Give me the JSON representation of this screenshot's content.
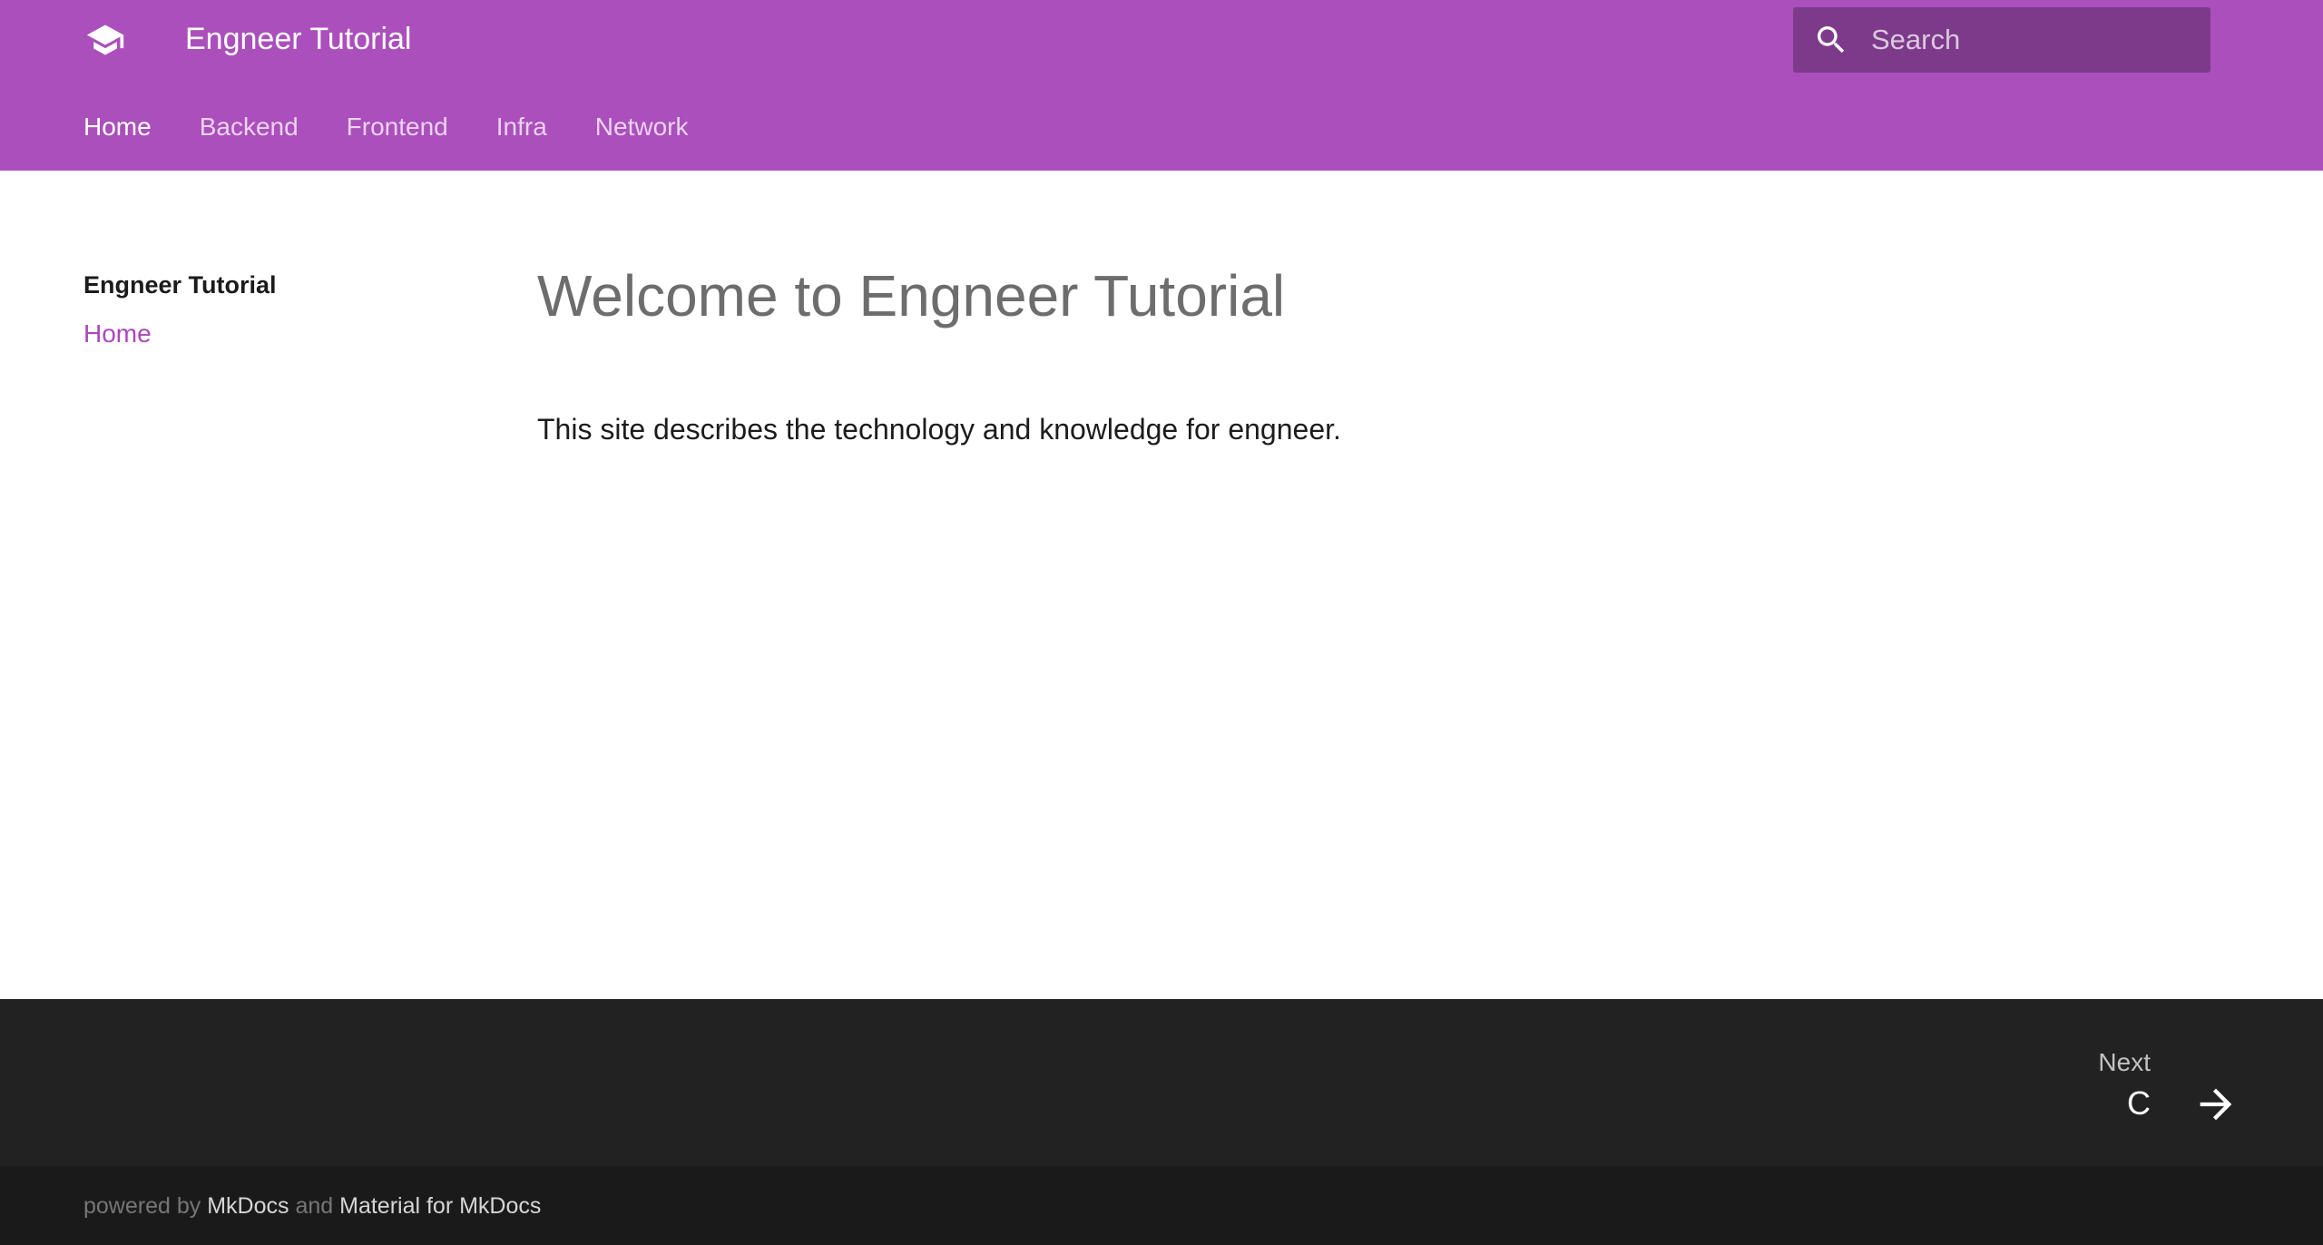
{
  "header": {
    "logo_icon": "school-icon",
    "title": "Engneer Tutorial",
    "search": {
      "icon": "search-icon",
      "placeholder": "Search",
      "value": ""
    },
    "tabs": [
      {
        "label": "Home",
        "active": true
      },
      {
        "label": "Backend",
        "active": false
      },
      {
        "label": "Frontend",
        "active": false
      },
      {
        "label": "Infra",
        "active": false
      },
      {
        "label": "Network",
        "active": false
      }
    ]
  },
  "sidebar": {
    "title": "Engneer Tutorial",
    "items": [
      {
        "label": "Home"
      }
    ]
  },
  "main": {
    "title": "Welcome to Engneer Tutorial",
    "text": "This site describes the technology and knowledge for engneer."
  },
  "footer": {
    "next": {
      "caption": "Next",
      "title": "C",
      "icon": "arrow-forward-icon"
    },
    "powered_by": "powered by",
    "mkdocs": "MkDocs",
    "and": "and",
    "material": "Material for MkDocs"
  },
  "colors": {
    "primary": "#ab4fbc",
    "search_bg": "#7d3a8b",
    "link": "#ab47bc",
    "footer": "#222222",
    "footer_meta": "#1a1a1a"
  }
}
